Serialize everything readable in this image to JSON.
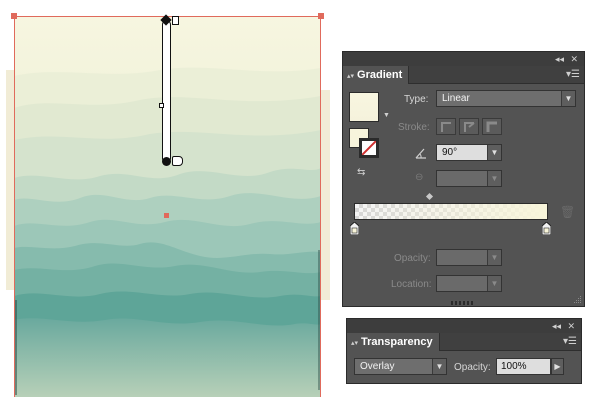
{
  "colors": {
    "panel_bg": "#535353",
    "panel_header": "#404040",
    "selection": "#e06a5c",
    "sky_top": "#f7f6e0",
    "mist_teal": "#7fbab0",
    "deep_teal": "#3f9b8e"
  },
  "canvas": {
    "artwork": "misty-mountains-gradient",
    "annotator_direction": "90°"
  },
  "gradient_panel": {
    "collapse_icon": "double-chevron-icon",
    "close_label": "✕",
    "tab_label": "Gradient",
    "type_label": "Type:",
    "type_value": "Linear",
    "stroke_label": "Stroke:",
    "angle_value": "90°",
    "aspect_value": "",
    "opacity_label": "Opacity:",
    "opacity_value": "",
    "location_label": "Location:",
    "location_value": "",
    "stops": [
      {
        "color": "#f8f5da",
        "opacity": 0,
        "location": 0
      },
      {
        "color": "#f8f5da",
        "opacity": 100,
        "location": 100
      }
    ]
  },
  "transparency_panel": {
    "close_label": "✕",
    "tab_label": "Transparency",
    "blend_mode": "Overlay",
    "opacity_label": "Opacity:",
    "opacity_value": "100%"
  }
}
